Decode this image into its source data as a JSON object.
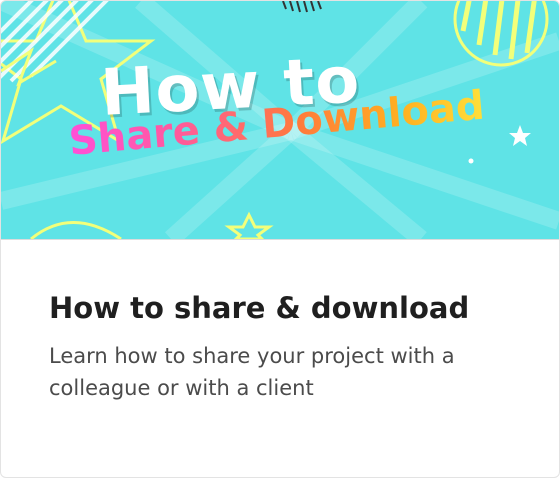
{
  "banner": {
    "line1": "How to",
    "line2": "Share & Download",
    "background_color": "#5fe3e6",
    "decoration_color": "#f2ff7a"
  },
  "card": {
    "title": "How to share & download",
    "description": "Learn how to share your project with a colleague or with a client"
  }
}
